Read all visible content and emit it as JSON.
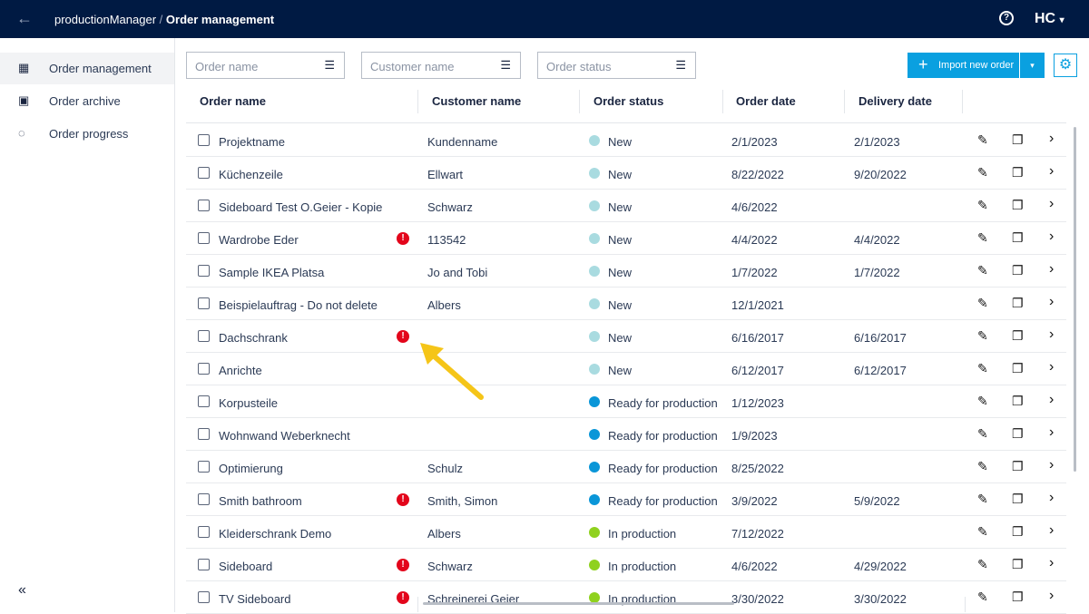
{
  "header": {
    "back_icon": "arrow-left-icon",
    "app": "productionManager",
    "separator": "/",
    "page": "Order management",
    "help_icon": "help-circle-icon",
    "logo": "HC",
    "logo_caret": "▾"
  },
  "sidebar": {
    "items": [
      {
        "label": "Order management",
        "icon": "list-icon",
        "active": true
      },
      {
        "label": "Order archive",
        "icon": "archive-icon"
      },
      {
        "label": "Order progress",
        "icon": "progress-icon"
      }
    ],
    "collapse": "«"
  },
  "filters": [
    {
      "placeholder": "Order name"
    },
    {
      "placeholder": "Customer name"
    },
    {
      "placeholder": "Order status"
    }
  ],
  "toolbar": {
    "import_label": "Import new order",
    "plus": "+",
    "caret": "▾",
    "settings_icon": "gear-icon"
  },
  "columns": [
    "Order name",
    "Customer name",
    "Order status",
    "Order date",
    "Delivery date"
  ],
  "status_colors": {
    "New": "#a9dbe0",
    "Ready for production": "#0a96d8",
    "In production": "#8fd11e"
  },
  "rows": [
    {
      "name": "Projektname",
      "warn": false,
      "customer": "Kundenname",
      "status": "New",
      "order_date": "2/1/2023",
      "delivery_date": "2/1/2023"
    },
    {
      "name": "Küchenzeile",
      "warn": false,
      "customer": "Ellwart",
      "status": "New",
      "order_date": "8/22/2022",
      "delivery_date": "9/20/2022"
    },
    {
      "name": "Sideboard Test O.Geier - Kopie",
      "warn": false,
      "customer": "Schwarz",
      "status": "New",
      "order_date": "4/6/2022",
      "delivery_date": ""
    },
    {
      "name": "Wardrobe Eder",
      "warn": true,
      "customer": "113542",
      "status": "New",
      "order_date": "4/4/2022",
      "delivery_date": "4/4/2022"
    },
    {
      "name": "Sample IKEA Platsa",
      "warn": false,
      "customer": "Jo and Tobi",
      "status": "New",
      "order_date": "1/7/2022",
      "delivery_date": "1/7/2022"
    },
    {
      "name": "Beispielauftrag - Do not delete",
      "warn": false,
      "customer": "Albers",
      "status": "New",
      "order_date": "12/1/2021",
      "delivery_date": ""
    },
    {
      "name": "Dachschrank",
      "warn": true,
      "customer": "",
      "status": "New",
      "order_date": "6/16/2017",
      "delivery_date": "6/16/2017"
    },
    {
      "name": "Anrichte",
      "warn": false,
      "customer": "",
      "status": "New",
      "order_date": "6/12/2017",
      "delivery_date": "6/12/2017"
    },
    {
      "name": "Korpusteile",
      "warn": false,
      "customer": "",
      "status": "Ready for production",
      "order_date": "1/12/2023",
      "delivery_date": ""
    },
    {
      "name": "Wohnwand Weberknecht",
      "warn": false,
      "customer": "",
      "status": "Ready for production",
      "order_date": "1/9/2023",
      "delivery_date": ""
    },
    {
      "name": "Optimierung",
      "warn": false,
      "customer": "Schulz",
      "status": "Ready for production",
      "order_date": "8/25/2022",
      "delivery_date": ""
    },
    {
      "name": "Smith bathroom",
      "warn": true,
      "customer": "Smith, Simon",
      "status": "Ready for production",
      "order_date": "3/9/2022",
      "delivery_date": "5/9/2022"
    },
    {
      "name": "Kleiderschrank Demo",
      "warn": false,
      "customer": "Albers",
      "status": "In production",
      "order_date": "7/12/2022",
      "delivery_date": ""
    },
    {
      "name": "Sideboard",
      "warn": true,
      "customer": "Schwarz",
      "status": "In production",
      "order_date": "4/6/2022",
      "delivery_date": "4/29/2022"
    },
    {
      "name": "TV Sideboard",
      "warn": true,
      "customer": "Schreinerei Geier",
      "status": "In production",
      "order_date": "3/30/2022",
      "delivery_date": "3/30/2022"
    }
  ],
  "row_icons": {
    "warn": "!",
    "edit": "✎",
    "copy": "❐",
    "open": "›"
  },
  "annotation_color": "#f5c518"
}
